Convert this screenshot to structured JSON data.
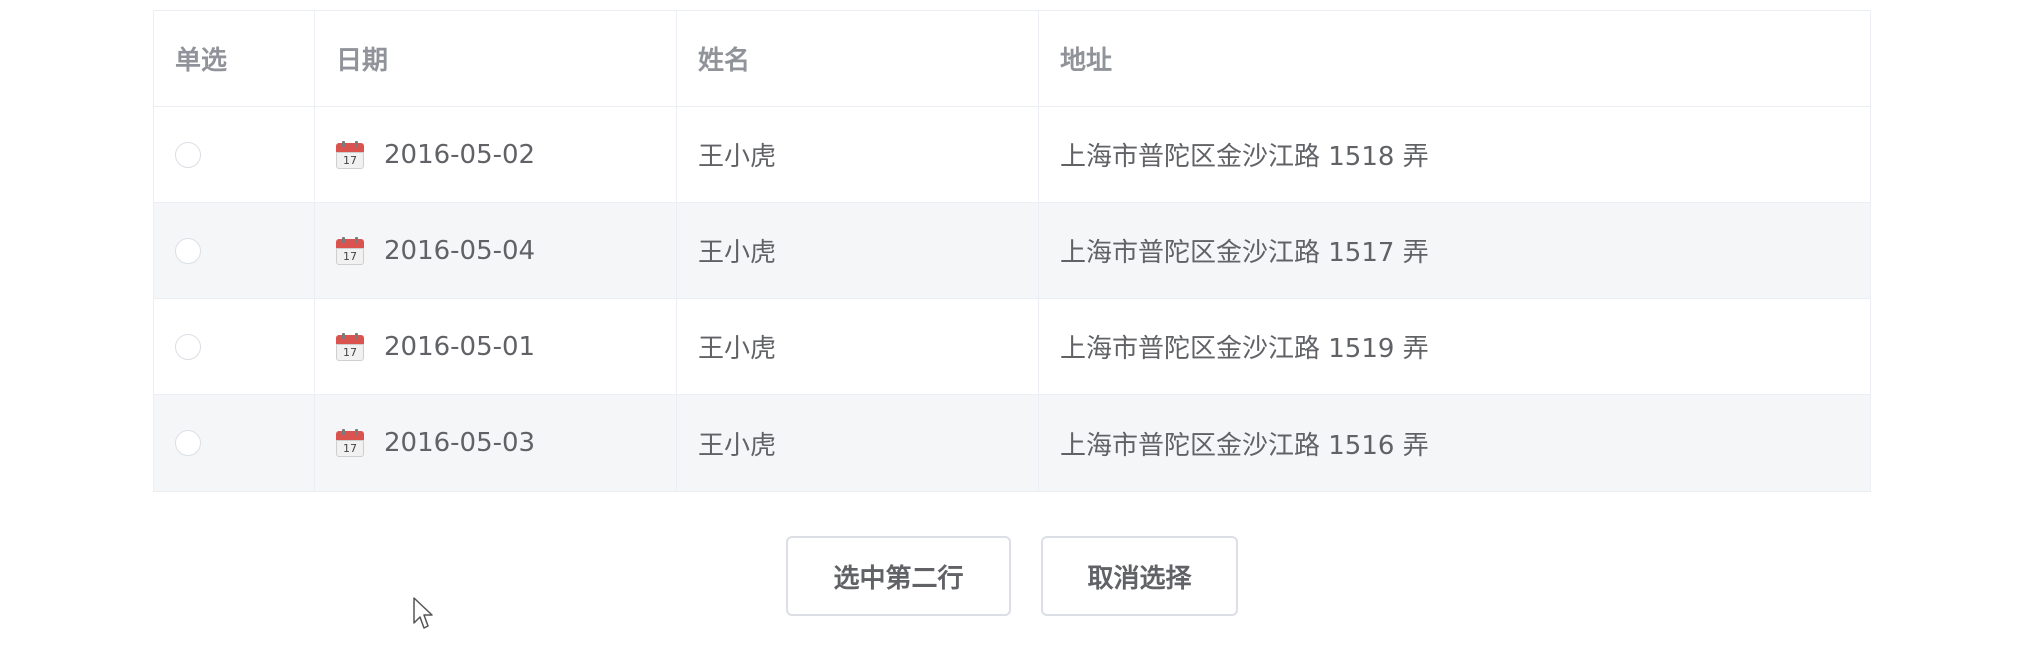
{
  "table": {
    "headers": {
      "radio": "单选",
      "date": "日期",
      "name": "姓名",
      "address": "地址"
    },
    "rows": [
      {
        "date": "2016-05-02",
        "name": "王小虎",
        "address": "上海市普陀区金沙江路 1518 弄",
        "selected": false
      },
      {
        "date": "2016-05-04",
        "name": "王小虎",
        "address": "上海市普陀区金沙江路 1517 弄",
        "selected": false
      },
      {
        "date": "2016-05-01",
        "name": "王小虎",
        "address": "上海市普陀区金沙江路 1519 弄",
        "selected": false
      },
      {
        "date": "2016-05-03",
        "name": "王小虎",
        "address": "上海市普陀区金沙江路 1516 弄",
        "selected": false
      }
    ],
    "calendar_icon_day": "17"
  },
  "buttons": {
    "select_second": "选中第二行",
    "cancel_select": "取消选择"
  }
}
